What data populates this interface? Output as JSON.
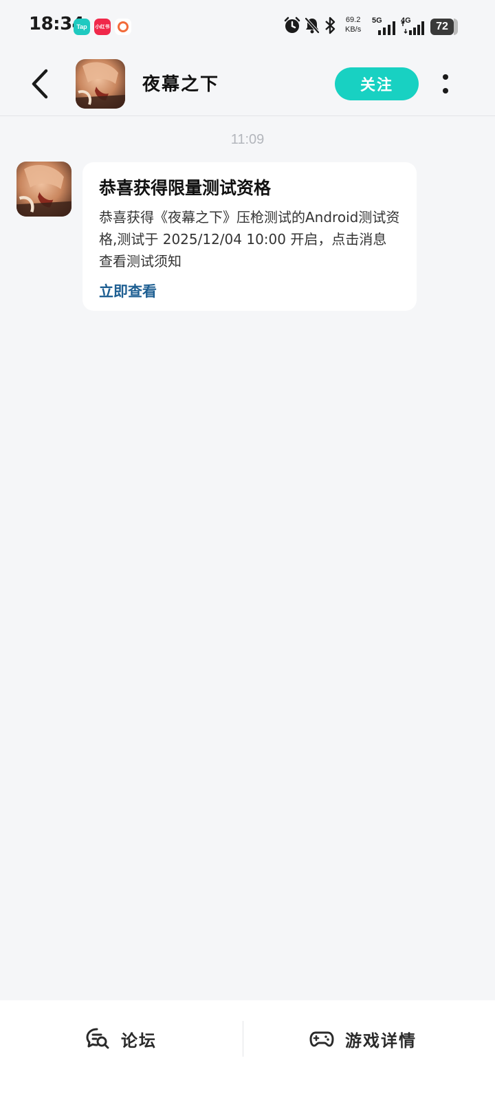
{
  "status_bar": {
    "time": "18:34",
    "app_badges": [
      {
        "name": "taptap",
        "label": "Tap"
      },
      {
        "name": "xiaohongshu",
        "label": "小红书"
      },
      {
        "name": "ring-app",
        "label": ""
      }
    ],
    "icons": [
      "alarm-icon",
      "mute-bell-icon",
      "bluetooth-icon"
    ],
    "net_speed_value": "69.2",
    "net_speed_unit": "KB/s",
    "network_1": "5G",
    "network_2": "4G",
    "battery": "72"
  },
  "header": {
    "title": "夜幕之下",
    "follow_label": "关注"
  },
  "chat": {
    "timestamp": "11:09",
    "message": {
      "title": "恭喜获得限量测试资格",
      "body": "恭喜获得《夜幕之下》压枪测试的Android测试资格,测试于 2025/12/04 10:00 开启，点击消息查看测试须知",
      "link": "立即查看"
    }
  },
  "bottom_bar": {
    "forum_label": "论坛",
    "details_label": "游戏详情"
  },
  "colors": {
    "accent": "#18d1c2",
    "link": "#1e5f92",
    "background": "#f5f6f8"
  }
}
